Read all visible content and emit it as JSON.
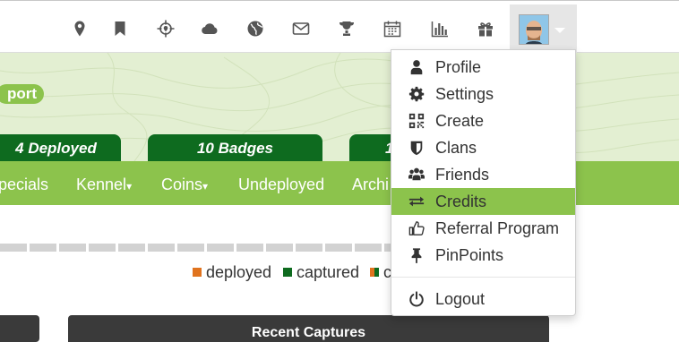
{
  "nav": {
    "icons": [
      "map-pin-icon",
      "bookmark-icon",
      "crosshair-icon",
      "cloud-icon",
      "globe-icon",
      "envelope-icon",
      "trophy-icon",
      "calendar-icon",
      "bar-chart-icon",
      "gift-icon"
    ]
  },
  "header": {
    "pill_label": "port",
    "tabs": [
      "4 Deployed",
      "10 Badges",
      "1"
    ]
  },
  "menu": {
    "items": [
      "pecials",
      "Kennel",
      "Coins",
      "Undeployed",
      "Archi"
    ],
    "dropdown_marker": "▾"
  },
  "legend": {
    "items": [
      {
        "label": "deployed",
        "color": "#e0731e"
      },
      {
        "label": "captured",
        "color": "#0e6b1f"
      },
      {
        "label": "c",
        "color": "#e0731e"
      }
    ]
  },
  "panels": {
    "recent_captures": "Recent Captures"
  },
  "user_menu": {
    "items": [
      {
        "label": "Profile",
        "icon": "user-icon"
      },
      {
        "label": "Settings",
        "icon": "gear-icon"
      },
      {
        "label": "Create",
        "icon": "qr-code-icon"
      },
      {
        "label": "Clans",
        "icon": "shield-icon"
      },
      {
        "label": "Friends",
        "icon": "users-icon"
      },
      {
        "label": "Credits",
        "icon": "exchange-icon",
        "active": true
      },
      {
        "label": "Referral Program",
        "icon": "thumbs-up-icon"
      },
      {
        "label": "PinPoints",
        "icon": "pushpin-icon"
      },
      {
        "label": "Logout",
        "icon": "power-icon"
      }
    ]
  },
  "colors": {
    "accent_green": "#8cc34c",
    "dark_green": "#0e6b1f",
    "orange": "#e0731e"
  }
}
